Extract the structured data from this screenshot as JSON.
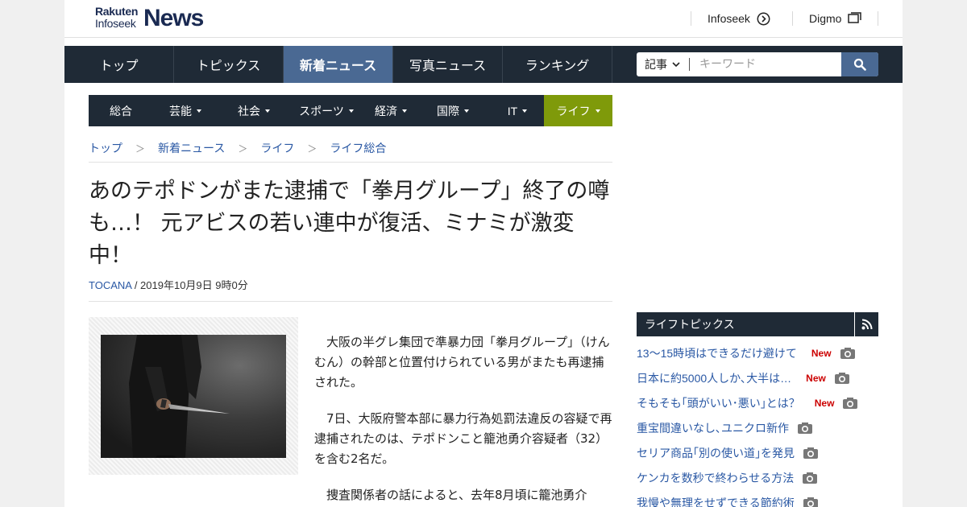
{
  "header": {
    "logo_line1": "Rakuten",
    "logo_line2": "Infoseek",
    "logo_main": "News",
    "links": [
      {
        "label": "Infoseek",
        "icon": "arrow-circle-icon"
      },
      {
        "label": "Digmo",
        "icon": "windows-icon"
      }
    ]
  },
  "main_nav": {
    "items": [
      "トップ",
      "トピックス",
      "新着ニュース",
      "写真ニュース",
      "ランキング"
    ],
    "active_index": 2
  },
  "search": {
    "category": "記事",
    "placeholder": "キーワード",
    "icon": "search-icon"
  },
  "category_nav": {
    "items": [
      {
        "label": "総合",
        "dropdown": false
      },
      {
        "label": "芸能",
        "dropdown": true
      },
      {
        "label": "社会",
        "dropdown": true
      },
      {
        "label": "スポーツ",
        "dropdown": true
      },
      {
        "label": "経済",
        "dropdown": true
      },
      {
        "label": "国際",
        "dropdown": true
      },
      {
        "label": "IT",
        "dropdown": true
      },
      {
        "label": "ライフ",
        "dropdown": true
      }
    ],
    "active_index": 7,
    "active_color": "#7f9a0a"
  },
  "breadcrumb": [
    "トップ",
    "新着ニュース",
    "ライフ",
    "ライフ総合"
  ],
  "article": {
    "title": "あのテポドンがまた逮捕で「拳月グループ」終了の噂も…！ 元アビスの若い連中が復活、ミナミが激変中！",
    "source": "TOCANA",
    "date": " / 2019年10月9日 9時0分",
    "paragraphs": [
      "大阪の半グレ集団で準暴力団「拳月グループ」（けんむん）の幹部と位置付けられている男がまたも再逮捕された。",
      "7日、大阪府警本部に暴力行為処罰法違反の容疑で再逮捕されたのは、テポドンこと籠池勇介容疑者（32）を含む2名だ。",
      "捜査関係者の話によると、去年8月頃に籠池勇介"
    ]
  },
  "sidebar": {
    "title": "ライフトピックス",
    "rss_icon": "rss-icon",
    "items": [
      {
        "text": "13～15時頃はできるだけ避けて",
        "new": "New"
      },
      {
        "text": "日本に約5000人しか､大半は…",
        "new": "New"
      },
      {
        "text": "そもそも｢頭がいい･悪い｣とは？",
        "new": "New"
      },
      {
        "text": "重宝間違いなし､ユニクロ新作",
        "new": ""
      },
      {
        "text": "セリア商品｢別の使い道｣を発見",
        "new": ""
      },
      {
        "text": "ケンカを数秒で終わらせる方法",
        "new": ""
      },
      {
        "text": "我慢や無理をせずできる節約術",
        "new": ""
      }
    ]
  },
  "colors": {
    "nav_bg": "#1f2a36",
    "nav_active": "#4a6993",
    "link": "#2a58a4",
    "new_badge": "#cc0000"
  }
}
